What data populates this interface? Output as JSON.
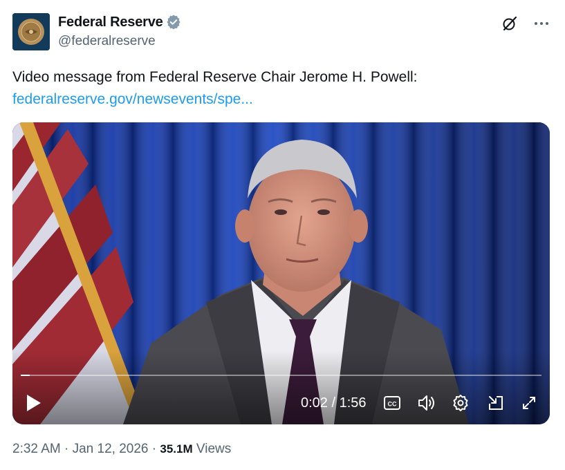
{
  "account": {
    "display_name": "Federal Reserve",
    "handle": "@federalreserve",
    "verified_icon": "verified-badge-icon",
    "avatar_icon": "federal-reserve-seal"
  },
  "tweet": {
    "text": "Video message from Federal Reserve Chair Jerome H. Powell:",
    "link_text": "federalreserve.gov/newsevents/spe..."
  },
  "video": {
    "elapsed": "0:02",
    "duration": "1:56",
    "time_display": "0:02 / 1:56",
    "progress_fraction": 0.017,
    "icons": [
      "play-icon",
      "captions-icon",
      "volume-icon",
      "settings-icon",
      "dock-icon",
      "fullscreen-icon"
    ]
  },
  "footer": {
    "time": "2:32 AM",
    "date": "Jan 12, 2026",
    "sep": "·",
    "views_count": "35.1M",
    "views_label": "Views"
  },
  "colors": {
    "link": "#1d9bf0",
    "secondary_text": "#536471",
    "verified": "#829aab"
  }
}
